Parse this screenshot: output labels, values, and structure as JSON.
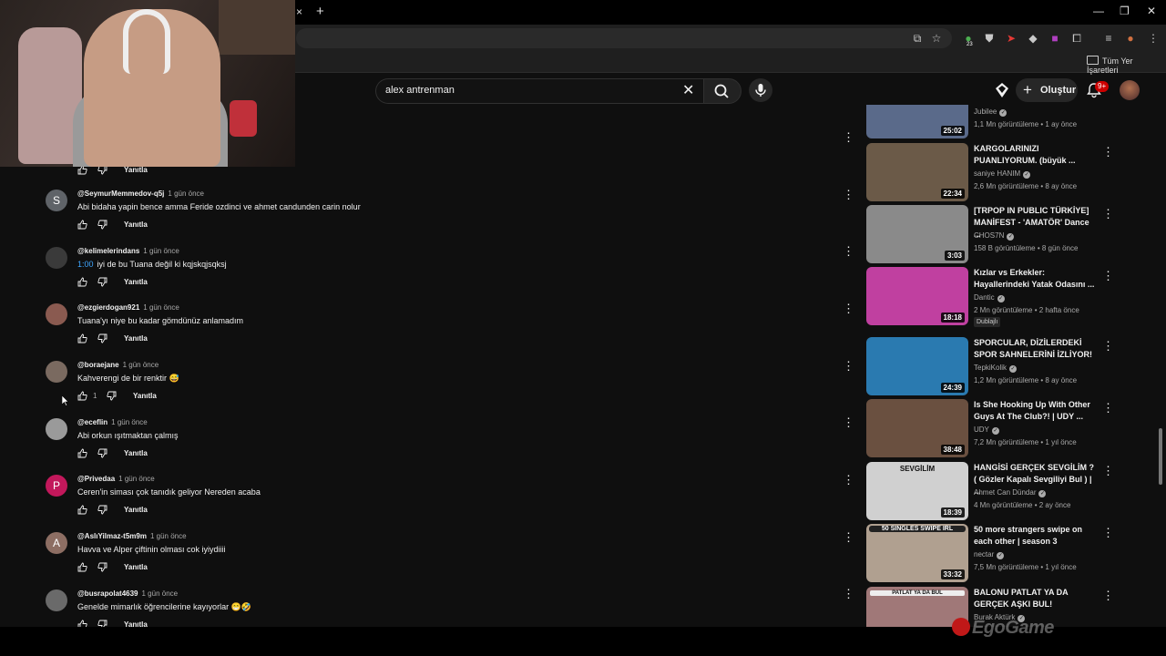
{
  "browser": {
    "bookmarks_folder": "Tüm Yer İşaretleri",
    "new_tab": "+",
    "tab_close": "×",
    "ext_badge": "23"
  },
  "header": {
    "search_value": "alex antrenman",
    "create_label": "Oluştur",
    "notifications_badge": "9+"
  },
  "comment_ui": {
    "reply_label": "Yanıtla"
  },
  "comments": [
    {
      "avatar_letter": "S",
      "avatar_color": "#5f6368",
      "handle": "@SeymurMemmedov-q5j",
      "age": "1 gün önce",
      "text": "Abi bidaha yapin bence amma Feride ozdinci ve  ahmet candunden carin nolur"
    },
    {
      "avatar_letter": "",
      "avatar_color": "#3a3a3a",
      "handle": "@kelimelerindans",
      "age": "1 gün önce",
      "timestamp_link": "1:00",
      "text": "iyi de bu Tuana değil ki kqjskqjsqksj"
    },
    {
      "avatar_letter": "",
      "avatar_color": "#8a5a50",
      "handle": "@ezgierdogan921",
      "age": "1 gün önce",
      "text": "Tuana'yı niye bu kadar gömdünüz anlamadım"
    },
    {
      "avatar_letter": "",
      "avatar_color": "#7a6a60",
      "handle": "@boraejane",
      "age": "1 gün önce",
      "text": "Kahverengi de bir renktir 😅",
      "likes": "1"
    },
    {
      "avatar_letter": "",
      "avatar_color": "#9a9a9a",
      "handle": "@eceflin",
      "age": "1 gün önce",
      "text": "Abi orkun ışıtmaktan çalmış"
    },
    {
      "avatar_letter": "P",
      "avatar_color": "#c2185b",
      "handle": "@Privedaa",
      "age": "1 gün önce",
      "text": "Ceren'in siması çok tanıdık geliyor Nereden acaba"
    },
    {
      "avatar_letter": "A",
      "avatar_color": "#8d6e63",
      "handle": "@AslıYilmaz-t5m9m",
      "age": "1 gün önce",
      "text": "Havva ve Alper çiftinin olması cok iyiydiiii"
    },
    {
      "avatar_letter": "",
      "avatar_color": "#6a6a6a",
      "handle": "@busrapolat4639",
      "age": "1 gün önce",
      "text": "Genelde mimarlık öğrencilerine kayıyorlar 😁🤣"
    }
  ],
  "recommendations": [
    {
      "title": "",
      "channel": "Jubilee",
      "meta": "1,1 Mn görüntüleme • 1 ay önce",
      "duration": "25:02",
      "thumb_color": "#5a6a8a"
    },
    {
      "title": "KARGOLARINIZI PUANLIYORUM. (büyük ...",
      "channel": "saniye HANIM",
      "meta": "2,6 Mn görüntüleme • 8 ay önce",
      "duration": "22:34",
      "thumb_color": "#6b5a48"
    },
    {
      "title": "[TRPOP IN PUBLIC TÜRKİYE] MANİFEST - 'AMATÖR' Dance ...",
      "channel": "CHOS7N",
      "meta": "158 B görüntüleme • 8 gün önce",
      "duration": "3:03",
      "thumb_color": "#8a8a8a"
    },
    {
      "title": "Kızlar vs Erkekler: Hayallerindeki Yatak Odasını ...",
      "channel": "Dantic",
      "meta": "2 Mn görüntüleme • 2 hafta önce",
      "duration": "18:18",
      "thumb_color": "#c040a0",
      "badge": "Dublajlı"
    },
    {
      "title": "SPORCULAR, DİZİLERDEKİ SPOR SAHNELERİNİ İZLİYOR!",
      "channel": "TepkiKolik",
      "meta": "1,2 Mn görüntüleme • 8 ay önce",
      "duration": "24:39",
      "thumb_color": "#2a7ab0"
    },
    {
      "title": "Is She Hooking Up With Other Guys At The Club?! | UDY ...",
      "channel": "UDY",
      "meta": "7,2 Mn görüntüleme • 1 yıl önce",
      "duration": "38:48",
      "thumb_color": "#6a5040"
    },
    {
      "title": "HANGİSİ GERÇEK SEVGİLİM ? ( Gözler Kapalı Sevgiliyi Bul ) | ...",
      "channel": "Ahmet Can Dündar",
      "meta": "4 Mn görüntüleme • 2 ay önce",
      "duration": "18:39",
      "thumb_color": "#d0d0d0",
      "thumb_text": "SEVGİLİM"
    },
    {
      "title": "50 more strangers swipe on each other | season 3",
      "channel": "nectar",
      "meta": "7,5 Mn görüntüleme • 1 yıl önce",
      "duration": "33:32",
      "thumb_color": "#b0a090",
      "thumb_text": "50 SINGLES SWIPE IRL"
    },
    {
      "title": "BALONU PATLAT YA DA GERÇEK AŞKI BUL!",
      "channel": "Burak Aktürk",
      "meta": "",
      "duration": "",
      "thumb_color": "#a07878",
      "thumb_text": "PATLAT YA DA BUL"
    }
  ],
  "watermark": "EgoGame",
  "colors": {
    "accent_red": "#cc0000",
    "link_blue": "#3ea6ff",
    "background": "#0f0f0f"
  }
}
